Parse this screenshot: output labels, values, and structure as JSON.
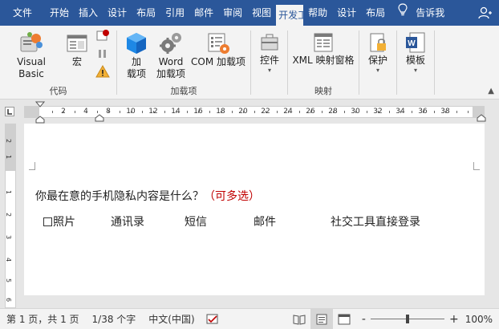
{
  "tabs": [
    "文件",
    "开始",
    "插入",
    "设计",
    "布局",
    "引用",
    "邮件",
    "审阅",
    "视图",
    "开发工具",
    "帮助",
    "设计",
    "布局"
  ],
  "active_tab_index": 9,
  "tell_me": "告诉我",
  "colors": {
    "brand": "#2b579a",
    "ribbon": "#f3f3f3",
    "accent_red": "#c00000",
    "dev_blue": "#1e88e5",
    "orange": "#ed7d31"
  },
  "ribbon": {
    "groups": {
      "code": "代码",
      "addins": "加载项",
      "mapping": "映射"
    },
    "buttons": {
      "visual_basic": "Visual Basic",
      "macro": "宏",
      "addin_1": "加",
      "addin_2": "载项",
      "word_addin_1": "Word",
      "word_addin_2": "加载项",
      "com_addin": "COM 加载项",
      "controls": "控件",
      "xml_mapping": "XML 映射窗格",
      "protect": "保护",
      "template": "模板"
    }
  },
  "ruler": {
    "numbers": [
      "2",
      "4",
      "8",
      "10",
      "12",
      "14",
      "16",
      "18",
      "20",
      "22",
      "24",
      "26",
      "28",
      "30",
      "32",
      "34",
      "36",
      "38"
    ]
  },
  "vruler": {
    "numbers": [
      "2",
      "1",
      "1",
      "2",
      "3",
      "4",
      "5",
      "6"
    ]
  },
  "document": {
    "question": "你最在意的手机隐私内容是什么？",
    "question_note": "（可多选）",
    "options": [
      "照片",
      "通讯录",
      "短信",
      "邮件",
      "社交工具直接登录"
    ]
  },
  "status": {
    "page": "第 1 页，共 1 页",
    "words": "1/38 个字",
    "language": "中文(中国)",
    "zoom_minus": "-",
    "zoom_plus": "+",
    "zoom": "100%",
    "zoom_level_fraction": 0.5
  }
}
